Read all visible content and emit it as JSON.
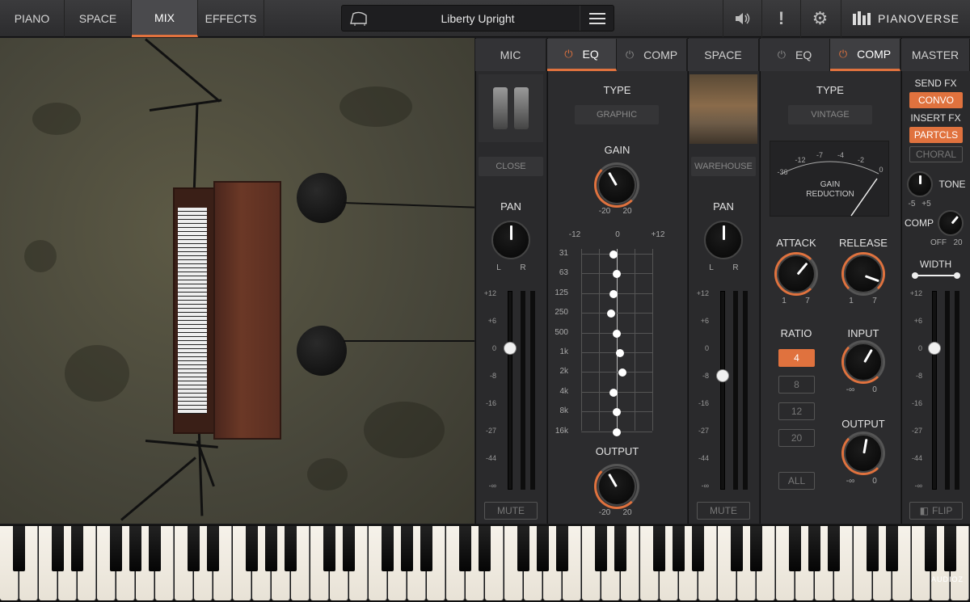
{
  "nav": {
    "tabs": [
      {
        "label": "PIANO"
      },
      {
        "label": "SPACE"
      },
      {
        "label": "MIX"
      },
      {
        "label": "EFFECTS"
      }
    ],
    "active": "MIX"
  },
  "preset": {
    "name": "Liberty Upright"
  },
  "header_icons": [
    "speaker-icon",
    "alert-icon",
    "gear-icon"
  ],
  "logo": {
    "text": "PIANOVERSE"
  },
  "mic_section": {
    "tabs": {
      "mic": "MIC",
      "eq": "EQ",
      "comp": "COMP"
    },
    "mic_label": "CLOSE",
    "pan": {
      "label": "PAN",
      "left": "L",
      "right": "R"
    },
    "fader": {
      "scale": [
        "+12",
        "+6",
        "0",
        "-8",
        "-16",
        "-27",
        "-44",
        "-∞"
      ],
      "value_db": 0
    },
    "mute_label": "MUTE"
  },
  "eq_section": {
    "type_label": "TYPE",
    "type_value": "GRAPHIC",
    "gain": {
      "label": "GAIN",
      "min": "-20",
      "max": "20"
    },
    "scale": {
      "min": "-12",
      "mid": "0",
      "max": "+12"
    },
    "bands": [
      {
        "freq": "31",
        "gain": -1
      },
      {
        "freq": "63",
        "gain": 0
      },
      {
        "freq": "125",
        "gain": -1
      },
      {
        "freq": "250",
        "gain": -2
      },
      {
        "freq": "500",
        "gain": 0
      },
      {
        "freq": "1k",
        "gain": 1
      },
      {
        "freq": "2k",
        "gain": 2
      },
      {
        "freq": "4k",
        "gain": -1
      },
      {
        "freq": "8k",
        "gain": 0
      },
      {
        "freq": "16k",
        "gain": 0
      }
    ],
    "output": {
      "label": "OUTPUT",
      "min": "-20",
      "max": "20"
    }
  },
  "space_section": {
    "tabs": {
      "space": "SPACE",
      "eq": "EQ",
      "comp": "COMP"
    },
    "room_label": "WAREHOUSE",
    "pan": {
      "label": "PAN",
      "left": "L",
      "right": "R"
    },
    "fader": {
      "scale": [
        "+12",
        "+6",
        "0",
        "-8",
        "-16",
        "-27",
        "-44",
        "-∞"
      ],
      "value_db": -8
    },
    "mute_label": "MUTE"
  },
  "comp_section": {
    "type_label": "TYPE",
    "type_value": "VINTAGE",
    "meter": {
      "scale": [
        "-36",
        "-12",
        "-7",
        "-4",
        "-2",
        "0"
      ],
      "title": "GAIN\nREDUCTION",
      "title1": "GAIN",
      "title2": "REDUCTION"
    },
    "attack": {
      "label": "ATTACK",
      "min": "1",
      "max": "7"
    },
    "release": {
      "label": "RELEASE",
      "min": "1",
      "max": "7"
    },
    "ratio": {
      "label": "RATIO",
      "options": [
        "4",
        "8",
        "12",
        "20"
      ],
      "selected": "4",
      "all": "ALL"
    },
    "input": {
      "label": "INPUT",
      "min": "-∞",
      "max": "0"
    },
    "output": {
      "label": "OUTPUT",
      "min": "-∞",
      "max": "0"
    }
  },
  "master_section": {
    "tab": "MASTER",
    "send_fx": "SEND FX",
    "send_value": "CONVO",
    "insert_fx": "INSERT FX",
    "insert_values": [
      "PARTCLS",
      "CHORAL"
    ],
    "tone": {
      "label": "TONE",
      "min": "-5",
      "max": "+5"
    },
    "comp": {
      "label": "COMP",
      "min": "OFF",
      "max": "20"
    },
    "width": {
      "label": "WIDTH"
    },
    "fader": {
      "scale": [
        "+12",
        "+6",
        "0",
        "-8",
        "-16",
        "-27",
        "-44",
        "-∞"
      ],
      "value_db": 0
    },
    "flip_label": "FLIP"
  },
  "watermark": "AUDIOZ"
}
